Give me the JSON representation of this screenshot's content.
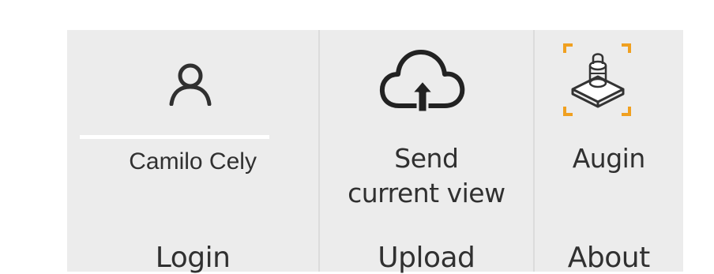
{
  "groups": {
    "login": {
      "label": "Login",
      "button_label": "Camilo Cely",
      "icon": "user-icon"
    },
    "upload": {
      "label": "Upload",
      "button_label_line1": "Send",
      "button_label_line2": "current view",
      "icon": "cloud-upload-icon"
    },
    "about": {
      "label": "About",
      "button_label": "Augin",
      "icon": "augin-logo-icon"
    }
  },
  "colors": {
    "ribbon_bg": "#ececec",
    "text": "#303030",
    "accent_orange": "#f0a020",
    "separator": "#dcdcdc"
  }
}
